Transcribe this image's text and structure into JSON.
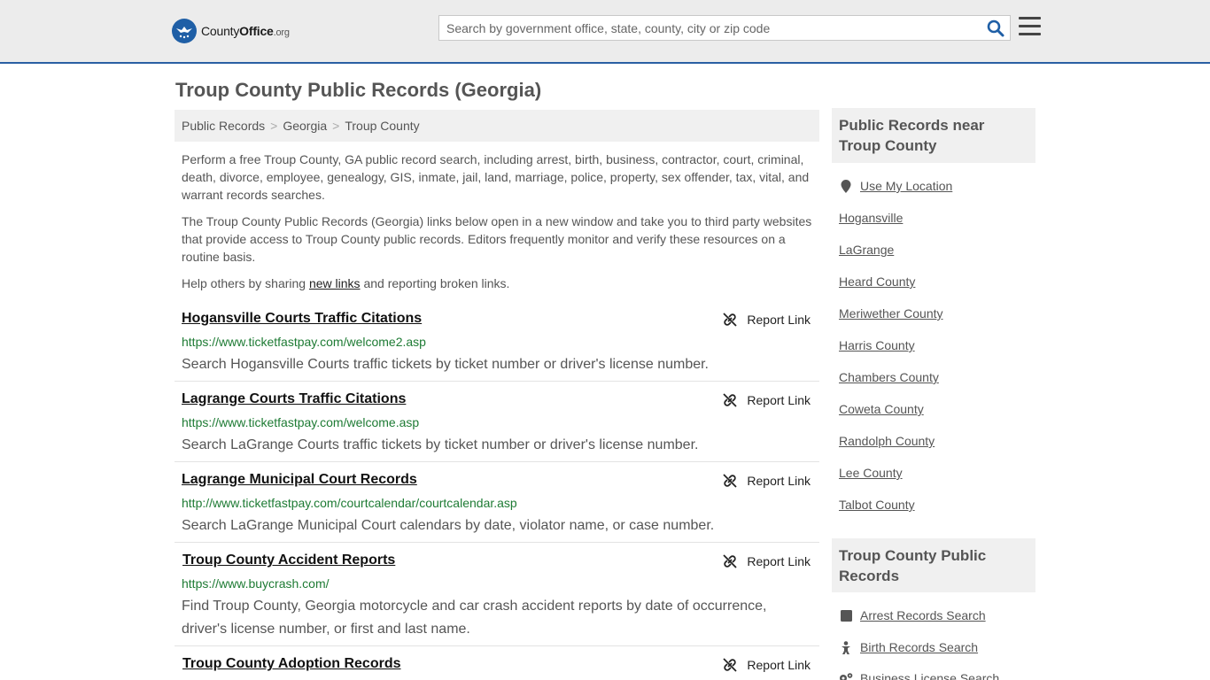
{
  "header": {
    "logo_main": "County",
    "logo_accent": "Office",
    "logo_org": ".org",
    "search_placeholder": "Search by government office, state, county, city or zip code"
  },
  "page_title": "Troup County Public Records (Georgia)",
  "breadcrumb": [
    "Public Records",
    "Georgia",
    "Troup County"
  ],
  "intro": {
    "p1": "Perform a free Troup County, GA public record search, including arrest, birth, business, contractor, court, criminal, death, divorce, employee, genealogy, GIS, inmate, jail, land, marriage, police, property, sex offender, tax, vital, and warrant records searches.",
    "p2": "The Troup County Public Records (Georgia) links below open in a new window and take you to third party websites that provide access to Troup County public records. Editors frequently monitor and verify these resources on a routine basis.",
    "p3_before": "Help others by sharing ",
    "p3_link": "new links",
    "p3_after": " and reporting broken links."
  },
  "report_label": "Report Link",
  "records": [
    {
      "title": "Hogansville Courts Traffic Citations",
      "url": "https://www.ticketfastpay.com/welcome2.asp",
      "desc": "Search Hogansville Courts traffic tickets by ticket number or driver's license number."
    },
    {
      "title": "Lagrange Courts Traffic Citations",
      "url": "https://www.ticketfastpay.com/welcome.asp",
      "desc": "Search LaGrange Courts traffic tickets by ticket number or driver's license number."
    },
    {
      "title": "Lagrange Municipal Court Records",
      "url": "http://www.ticketfastpay.com/courtcalendar/courtcalendar.asp",
      "desc": "Search LaGrange Municipal Court calendars by date, violator name, or case number."
    },
    {
      "title": "Troup County Accident Reports",
      "url": "https://www.buycrash.com/",
      "desc": "Find Troup County, Georgia motorcycle and car crash accident reports by date of occurrence, driver's license number, or first and last name."
    },
    {
      "title": "Troup County Adoption Records",
      "url": "",
      "desc": ""
    }
  ],
  "sidebar": {
    "near_title": "Public Records near Troup County",
    "use_location": "Use My Location",
    "near_links": [
      "Hogansville",
      "LaGrange",
      "Heard County",
      "Meriwether County",
      "Harris County",
      "Chambers County",
      "Coweta County",
      "Randolph County",
      "Lee County",
      "Talbot County"
    ],
    "records_title": "Troup County Public Records",
    "record_links": [
      "Arrest Records Search",
      "Birth Records Search",
      "Business License Search"
    ]
  }
}
